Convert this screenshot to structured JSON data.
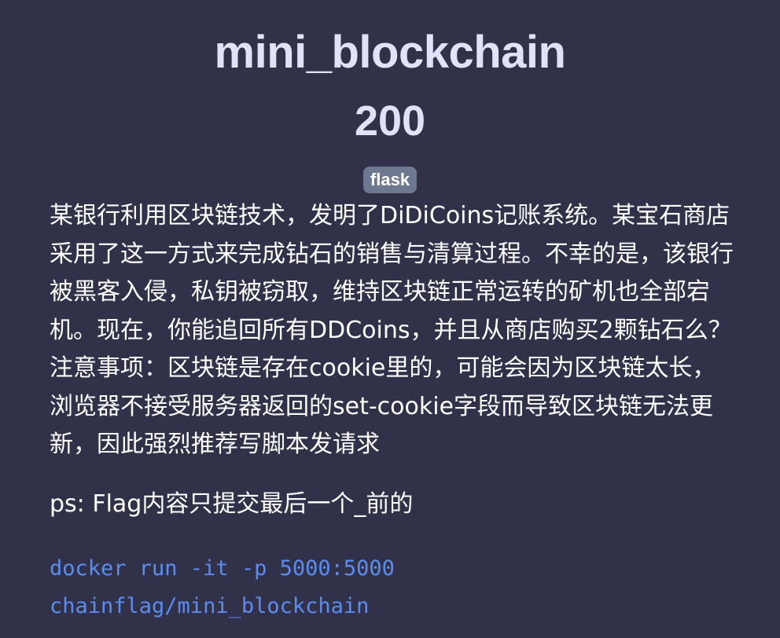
{
  "challenge": {
    "name": "mini_blockchain",
    "points": "200",
    "tag": "flask",
    "description": "某银行利用区块链技术，发明了DiDiCoins记账系统。某宝石商店采用了这一方式来完成钻石的销售与清算过程。不幸的是，该银行被黑客入侵，私钥被窃取，维持区块链正常运转的矿机也全部宕机。现在，你能追回所有DDCoins，并且从商店购买2颗钻石么？注意事项：区块链是存在cookie里的，可能会因为区块链太长，浏览器不接受服务器返回的set-cookie字段而导致区块链无法更新，因此强烈推荐写脚本发请求",
    "ps_note": "ps: Flag内容只提交最后一个_前的",
    "command_lines": [
      "docker run -it -p 5000:5000",
      "chainflag/mini_blockchain"
    ]
  },
  "colors": {
    "background": "#31324a",
    "title": "#e3e0fb",
    "tag_background": "#6f7891",
    "code": "#5b8df0"
  }
}
